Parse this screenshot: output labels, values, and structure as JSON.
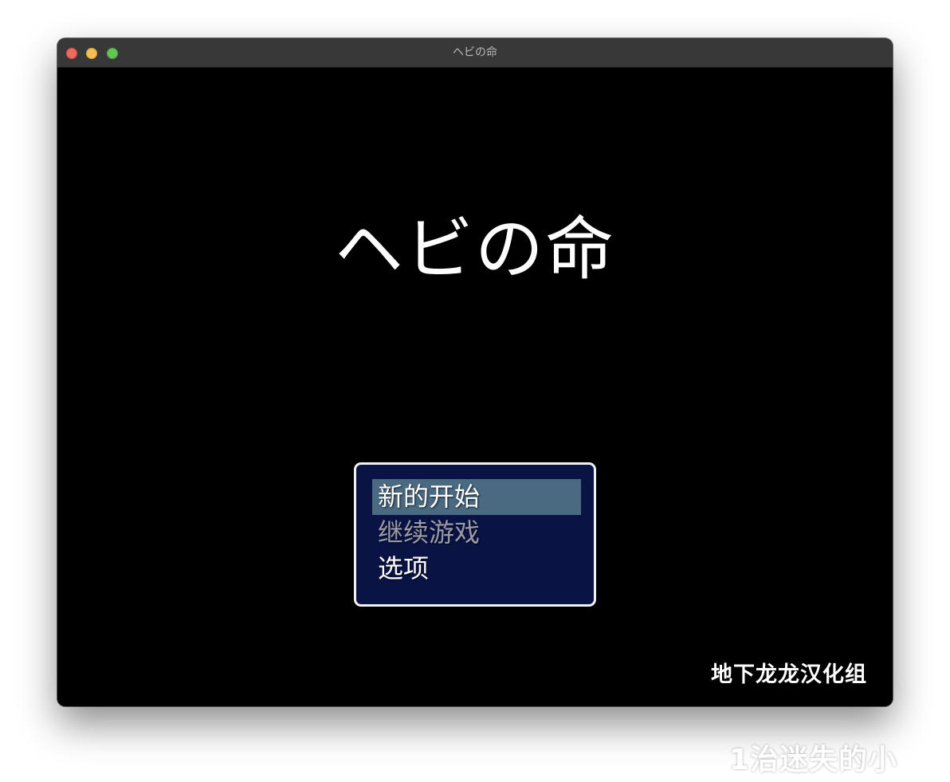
{
  "window": {
    "title": "ヘビの命"
  },
  "game": {
    "title": "ヘビの命",
    "menu": {
      "items": [
        {
          "label": "新的开始",
          "state": "selected"
        },
        {
          "label": "继续游戏",
          "state": "disabled"
        },
        {
          "label": "选项",
          "state": "normal"
        }
      ]
    },
    "credit": "地下龙龙汉化组"
  },
  "watermark": {
    "text": "1治迷失的小"
  },
  "colors": {
    "menu_background": "#0a1444",
    "menu_border": "#f2f2f2",
    "selection_highlight": "#4a6a82",
    "disabled_text": "#9a9aa8",
    "titlebar": "#383838"
  }
}
